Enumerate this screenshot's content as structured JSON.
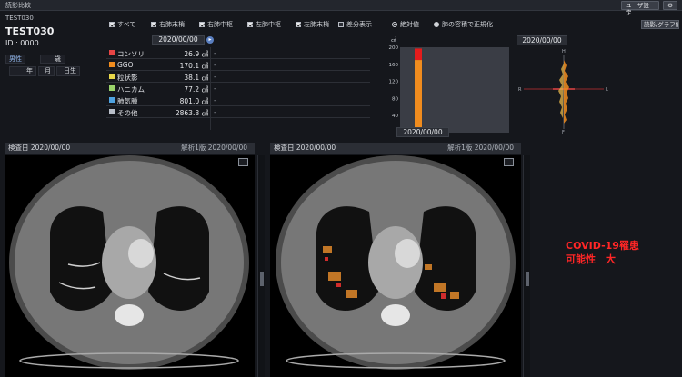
{
  "window": {
    "title": "読影比較",
    "user_settings": "ユーザ設定",
    "gear": "⚙"
  },
  "toolbar": {
    "layout_button": "読影/グラフ解析"
  },
  "patient": {
    "label": "TEST030",
    "name": "TEST030",
    "id": "ID : 0000",
    "sex": "男性",
    "age_unit": "歳",
    "dob_year": "年",
    "dob_month": "月",
    "dob_day": "日生"
  },
  "filters": {
    "checkboxes": [
      {
        "label": "すべて",
        "checked": true
      },
      {
        "label": "右肺末梢",
        "checked": true
      },
      {
        "label": "右肺中枢",
        "checked": true
      },
      {
        "label": "左肺中枢",
        "checked": true
      },
      {
        "label": "左肺末梢",
        "checked": true
      },
      {
        "label": "差分表示",
        "checked": false
      }
    ],
    "radios": [
      {
        "label": "絶対値",
        "selected": true
      },
      {
        "label": "肺の容積で正規化",
        "selected": false
      }
    ]
  },
  "table": {
    "date": "2020/00/00",
    "date_button": "▸",
    "rows": [
      {
        "label": "コンソリ",
        "value": "26.9 ㎤",
        "diff": "-",
        "color": "#e64545"
      },
      {
        "label": "GGO",
        "value": "170.1 ㎤",
        "diff": "-",
        "color": "#f08c1e"
      },
      {
        "label": "粒状影",
        "value": "38.1 ㎤",
        "diff": "-",
        "color": "#e8d84a"
      },
      {
        "label": "ハニカム",
        "value": "77.2 ㎤",
        "diff": "-",
        "color": "#9ad36a"
      },
      {
        "label": "肺気腫",
        "value": "801.0 ㎤",
        "diff": "-",
        "color": "#4fa3e0"
      },
      {
        "label": "その他",
        "value": "2863.8 ㎤",
        "diff": "-",
        "color": "#b9bfc9"
      }
    ]
  },
  "chart_data": {
    "type": "bar",
    "ylabel": "㎤",
    "ylim": [
      0,
      200
    ],
    "yticks": [
      40,
      80,
      120,
      160,
      200
    ],
    "categories": [
      "2020/00/00"
    ],
    "series": [
      {
        "values": [
          170.1
        ],
        "color": "#f08c1e"
      },
      {
        "values": [
          26.9
        ],
        "color": "#e41c1c"
      }
    ]
  },
  "distribution": {
    "date": "2020/00/00",
    "labels": {
      "top": "H",
      "bottom": "F",
      "left": "R",
      "right": "L"
    }
  },
  "viewers": [
    {
      "date_label": "検査日 2020/00/00",
      "version": "解析1版 2020/00/00"
    },
    {
      "date_label": "検査日 2020/00/00",
      "version": "解析1版 2020/00/00"
    }
  ],
  "result": {
    "text": "COVID-19罹患\n可能性　大",
    "color": "#ff2626"
  }
}
